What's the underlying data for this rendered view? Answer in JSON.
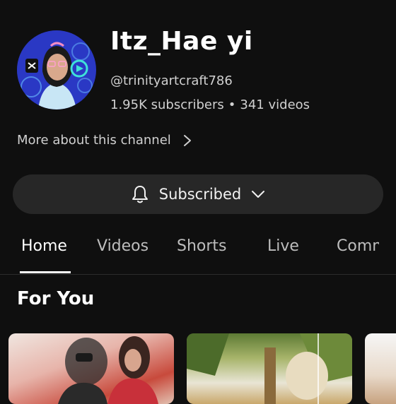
{
  "channel": {
    "name": "Itz_Hae yi",
    "handle": "@trinityartcraft786",
    "subscribers": "1.95K subscribers",
    "separator": "•",
    "videos": "341 videos",
    "more_about": "More about this channel"
  },
  "subscribe": {
    "label": "Subscribed",
    "bell_icon": "bell-icon",
    "dropdown_icon": "chevron-down-icon"
  },
  "tabs": [
    {
      "label": "Home",
      "active": true
    },
    {
      "label": "Videos",
      "active": false
    },
    {
      "label": "Shorts",
      "active": false
    },
    {
      "label": "Live",
      "active": false
    },
    {
      "label": "Comm",
      "active": false
    }
  ],
  "section": {
    "title": "For You"
  },
  "colors": {
    "background": "#0f0f0f",
    "button": "#272727",
    "text_primary": "#ffffff",
    "text_secondary": "#d0d0d0"
  }
}
